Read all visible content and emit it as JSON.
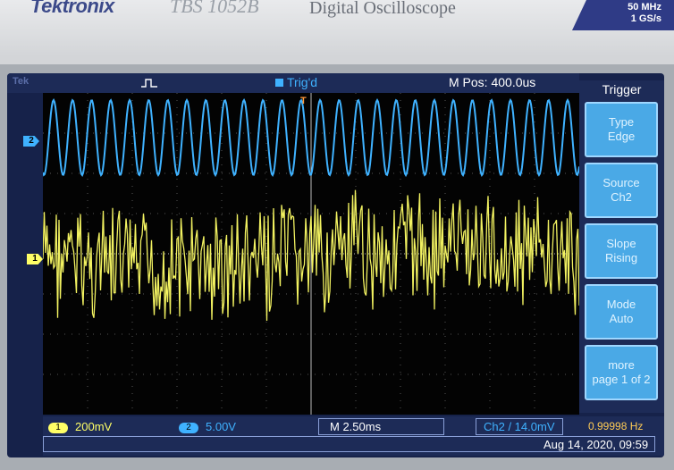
{
  "header": {
    "brand": "Tektronix",
    "model": "TBS 1052B",
    "subtitle": "Digital Oscilloscope",
    "spec_bandwidth": "50 MHz",
    "spec_samplerate": "1 GS/s"
  },
  "status": {
    "tek": "Tek",
    "trigger_state": "Trig'd",
    "horizontal_position": "M Pos: 400.0us"
  },
  "menu": {
    "title": "Trigger",
    "items": [
      {
        "line1": "Type",
        "line2": "Edge"
      },
      {
        "line1": "Source",
        "line2": "Ch2"
      },
      {
        "line1": "Slope",
        "line2": "Rising"
      },
      {
        "line1": "Mode",
        "line2": "Auto"
      },
      {
        "line1": "more",
        "line2": "page 1 of 2"
      }
    ]
  },
  "readouts": {
    "ch1_num": "1",
    "ch1_scale": "200mV",
    "ch2_num": "2",
    "ch2_scale": "5.00V",
    "timebase": "M 2.50ms",
    "trigger_readout": "Ch2 / 14.0mV",
    "frequency": "0.99998 Hz",
    "datetime": "Aug 14, 2020, 09:59"
  },
  "markers": {
    "ch1": "1",
    "ch2": "2",
    "trigger": "T"
  },
  "colors": {
    "ch1_trace": "#ffff66",
    "ch2_trace": "#3fb2ff",
    "menu_button": "#4aa9e6",
    "brand": "#3c4a8a"
  },
  "icons": {
    "acquisition": "pulse-icon"
  }
}
